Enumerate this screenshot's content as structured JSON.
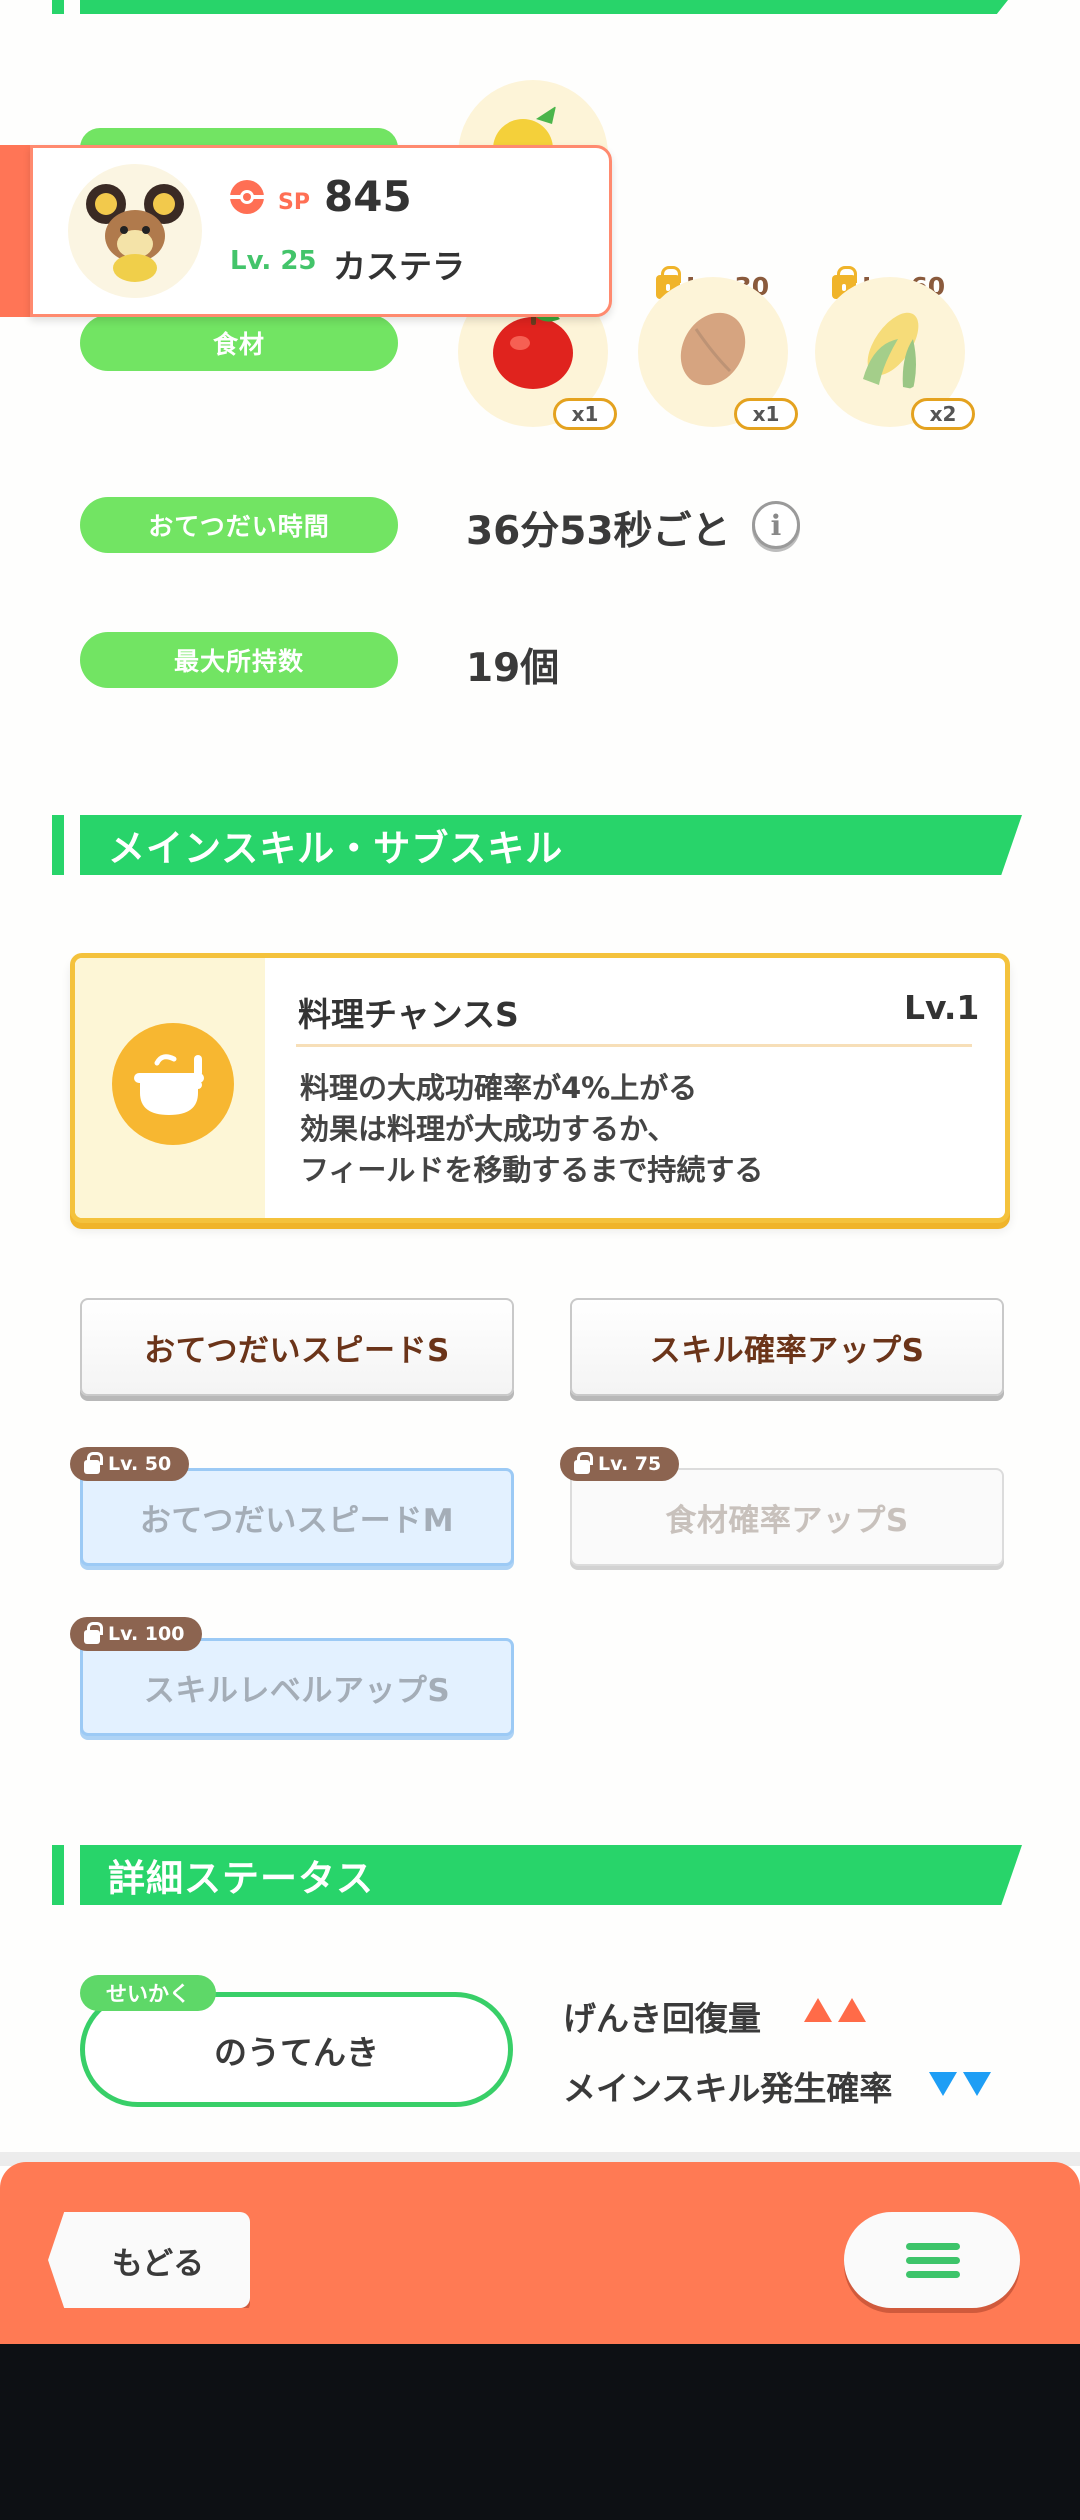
{
  "header_fragment": {},
  "pokemon_card": {
    "sp_label": "SP",
    "sp_value": "845",
    "level": "Lv. 25",
    "name": "カステラ"
  },
  "ingredients": {
    "label": "食材",
    "items": [
      {
        "name": "apple-icon",
        "qty": "x1",
        "unlock": ""
      },
      {
        "name": "cacao-icon",
        "qty": "x1",
        "unlock": "Lv. 30"
      },
      {
        "name": "corn-icon",
        "qty": "x2",
        "unlock": "Lv. 60"
      }
    ]
  },
  "help_time": {
    "label": "おてつだい時間",
    "value": "36分53秒ごと"
  },
  "max_carry": {
    "label": "最大所持数",
    "value": "19個"
  },
  "skills_section": {
    "title": "メインスキル・サブスキル",
    "main_skill": {
      "name": "料理チャンスS",
      "level": "Lv.1",
      "desc_line1": "料理の大成功確率が4%上がる",
      "desc_line2": "効果は料理が大成功するか、",
      "desc_line3": "フィールドを移動するまで持続する"
    },
    "sub_skills": [
      {
        "label": "おてつだいスピードS",
        "lock": ""
      },
      {
        "label": "スキル確率アップS",
        "lock": ""
      },
      {
        "label": "おてつだいスピードM",
        "lock": "Lv. 50"
      },
      {
        "label": "食材確率アップS",
        "lock": "Lv. 75"
      },
      {
        "label": "スキルレベルアップS",
        "lock": "Lv. 100"
      }
    ]
  },
  "details_section": {
    "title": "詳細ステータス",
    "nature_tag": "せいかく",
    "nature": "のうてんき",
    "up_effect": "げんき回復量",
    "down_effect": "メインスキル発生確率"
  },
  "nav": {
    "back_label": "もどる"
  },
  "colors": {
    "green": "#28d46a",
    "pill_green": "#72e463",
    "orange": "#ff7a54",
    "gold": "#f4c23c",
    "up_red": "#ff6b48",
    "down_blue": "#1e9ef5"
  }
}
